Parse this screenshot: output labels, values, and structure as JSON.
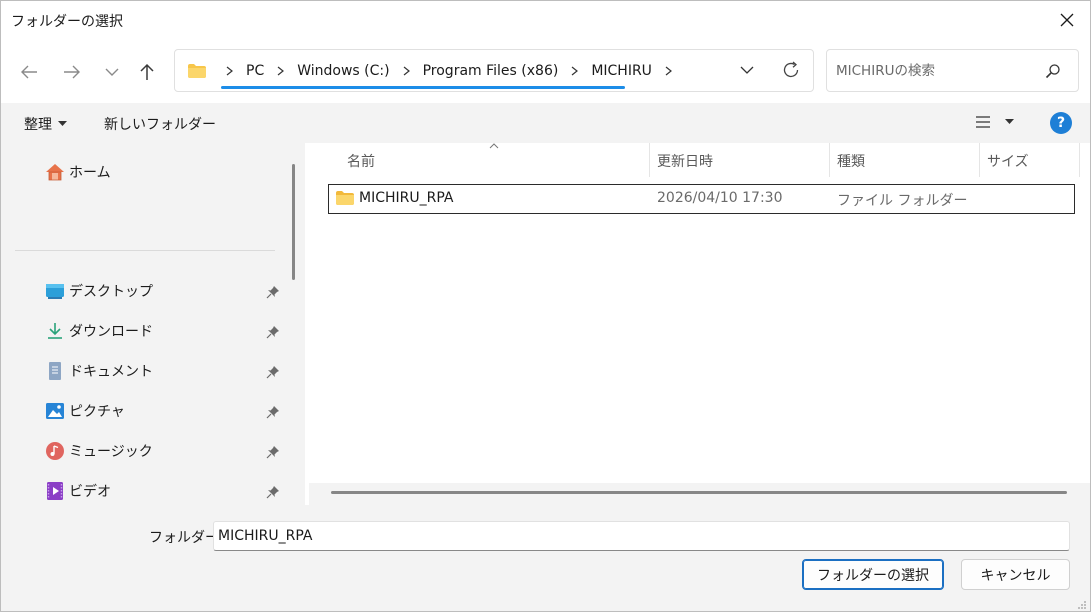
{
  "window": {
    "title": "フォルダーの選択"
  },
  "nav": {
    "breadcrumbs": [
      "PC",
      "Windows (C:)",
      "Program Files (x86)",
      "MICHIRU"
    ]
  },
  "search": {
    "placeholder": "MICHIRUの検索"
  },
  "toolbar": {
    "organize_label": "整理",
    "new_folder_label": "新しいフォルダー"
  },
  "sidebar": {
    "home": "ホーム",
    "items": [
      {
        "label": "デスクトップ",
        "icon": "desktop-icon"
      },
      {
        "label": "ダウンロード",
        "icon": "download-icon"
      },
      {
        "label": "ドキュメント",
        "icon": "document-icon"
      },
      {
        "label": "ピクチャ",
        "icon": "picture-icon"
      },
      {
        "label": "ミュージック",
        "icon": "music-icon"
      },
      {
        "label": "ビデオ",
        "icon": "video-icon"
      }
    ]
  },
  "list": {
    "columns": [
      "名前",
      "更新日時",
      "種類",
      "サイズ"
    ],
    "rows": [
      {
        "name": "MICHIRU_RPA",
        "modified": "2026/04/10 17:30",
        "type": "ファイル フォルダー",
        "size": ""
      }
    ]
  },
  "footer": {
    "folder_label": "フォルダー:",
    "folder_value": "MICHIRU_RPA",
    "select_button": "フォルダーの選択",
    "cancel_button": "キャンセル"
  },
  "colors": {
    "accent": "#1d8de8",
    "help": "#1e7fd6",
    "folder": "#f7c64a"
  }
}
